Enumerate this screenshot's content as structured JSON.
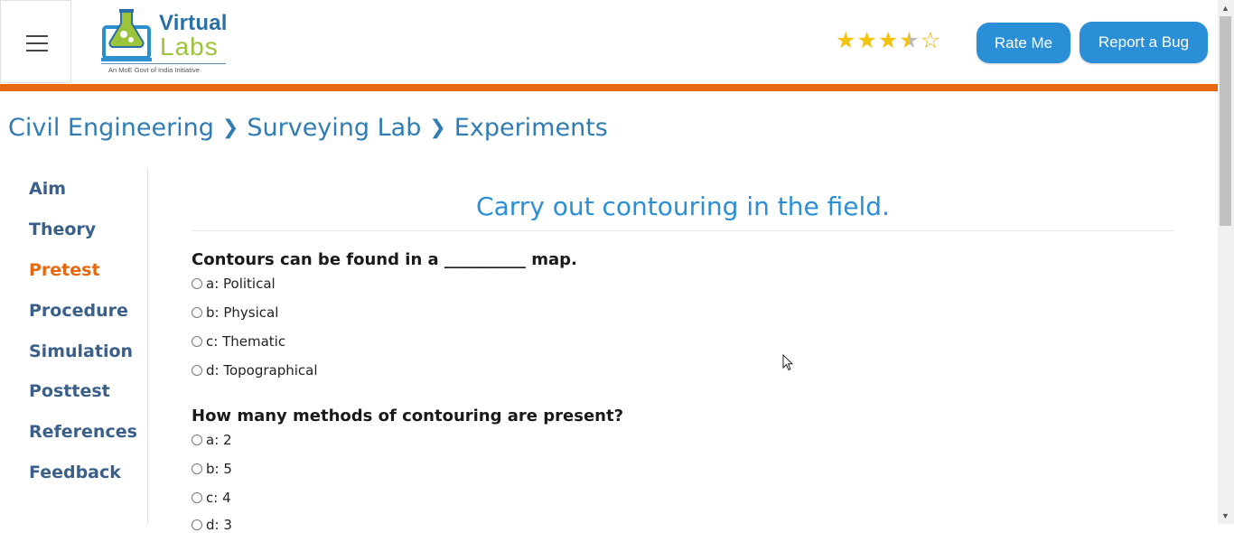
{
  "header": {
    "logo_line1": "Virtual",
    "logo_line2": "Labs",
    "logo_tagline": "An MoE Govt of India Initiative",
    "rating": {
      "value": 3.5,
      "max": 5
    },
    "rate_me": "Rate Me",
    "report_bug": "Report a Bug"
  },
  "breadcrumb": [
    "Civil Engineering",
    "Surveying Lab",
    "Experiments"
  ],
  "sidebar": {
    "items": [
      {
        "label": "Aim",
        "active": false
      },
      {
        "label": "Theory",
        "active": false
      },
      {
        "label": "Pretest",
        "active": true
      },
      {
        "label": "Procedure",
        "active": false
      },
      {
        "label": "Simulation",
        "active": false
      },
      {
        "label": "Posttest",
        "active": false
      },
      {
        "label": "References",
        "active": false
      },
      {
        "label": "Feedback",
        "active": false
      }
    ]
  },
  "main": {
    "title": "Carry out contouring in the field.",
    "questions": [
      {
        "text": "Contours can be found in a __________ map.",
        "options": [
          "a: Political",
          "b: Physical",
          "c: Thematic",
          "d: Topographical"
        ]
      },
      {
        "text": "How many methods of contouring are present?",
        "options": [
          "a: 2",
          "b: 5",
          "c: 4",
          "d: 3"
        ]
      }
    ]
  },
  "colors": {
    "accent": "#2a8fd6",
    "orange": "#e8680f",
    "nav": "#3a5f8a"
  },
  "icons": {
    "menu": "hamburger-icon",
    "star": "star-icon",
    "chevron": "chevron-right-icon",
    "cursor": "mouse-pointer-icon"
  }
}
